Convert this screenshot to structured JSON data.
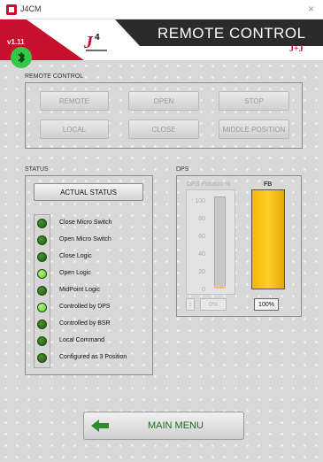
{
  "window": {
    "title": "J4CM",
    "close_glyph": "×"
  },
  "banner": {
    "version": "v1.11",
    "title": "REMOTE CONTROL",
    "logo_center": "J4",
    "logo_right": "J+J",
    "colors": {
      "red": "#c8102e",
      "dark": "#2b2b2b"
    }
  },
  "bluetooth": {
    "icon": "bluetooth-icon",
    "color": "#34c84a"
  },
  "remote_control": {
    "label": "REMOTE CONTROL",
    "buttons": [
      "REMOTE",
      "OPEN",
      "STOP",
      "LOCAL",
      "CLOSE",
      "MIDDLE POSITION"
    ]
  },
  "status": {
    "label": "STATUS",
    "actual_status_label": "ACTUAL STATUS",
    "items": [
      {
        "label": "Close Micro Switch",
        "on": false
      },
      {
        "label": "Open Micro Switch",
        "on": false
      },
      {
        "label": "Close Logic",
        "on": false
      },
      {
        "label": "Open Logic",
        "on": true
      },
      {
        "label": "MidPoint Logic",
        "on": false
      },
      {
        "label": "Controlled by DPS",
        "on": true
      },
      {
        "label": "Controlled by BSR",
        "on": false
      },
      {
        "label": "Local Command",
        "on": false
      },
      {
        "label": "Configured as 3 Position",
        "on": false
      }
    ]
  },
  "dps": {
    "label": "DPS",
    "position_gauge": {
      "title": "DPS Position %",
      "scale": [
        "100",
        "80",
        "60",
        "40",
        "20",
        "0"
      ],
      "value": 0,
      "display": "0%"
    },
    "fb_gauge": {
      "title": "FB",
      "value": 100,
      "display": "100%",
      "fill_color": "#f5b800"
    }
  },
  "main_menu": {
    "label": "MAIN MENU",
    "icon": "arrow-left-icon"
  }
}
